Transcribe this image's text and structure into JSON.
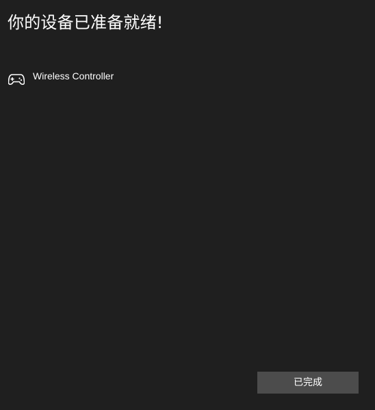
{
  "header": {
    "title": "你的设备已准备就绪!"
  },
  "devices": [
    {
      "name": "Wireless Controller",
      "icon": "gamepad-icon"
    }
  ],
  "footer": {
    "done_label": "已完成"
  },
  "colors": {
    "background": "#1f1f1f",
    "button_background": "#4c4c4c",
    "text": "#ffffff"
  }
}
